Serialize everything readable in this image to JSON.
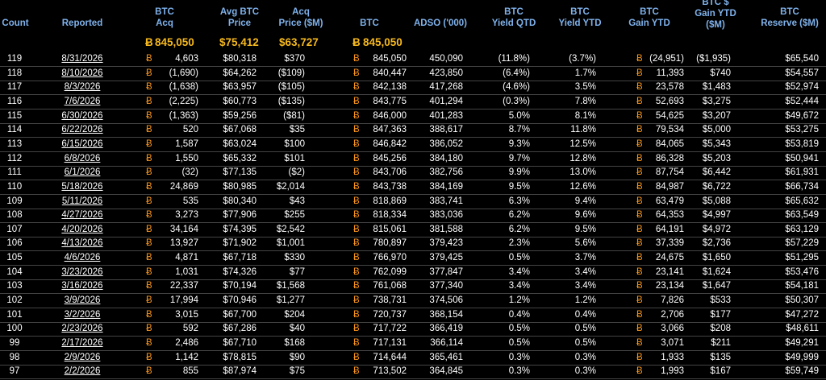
{
  "headers": {
    "count": "Count",
    "reported": "Reported",
    "btc_acq_1": "BTC",
    "btc_acq_2": "Acq",
    "avg_1": "Avg BTC",
    "avg_2": "Price",
    "acqp_1": "Acq",
    "acqp_2": "Price ($M)",
    "btc": "BTC",
    "adso": "ADSO ('000)",
    "qtd_1": "BTC",
    "qtd_2": "Yield QTD",
    "ytd_1": "BTC",
    "ytd_2": "Yield YTD",
    "gain_1": "BTC",
    "gain_2": "Gain YTD",
    "gainusd_1": "BTC $",
    "gainusd_2": "Gain YTD",
    "gainusd_3": "($M)",
    "res_1": "BTC",
    "res_2": "Reserve ($M)"
  },
  "btc_symbol": "Ƀ",
  "summary": {
    "btc_acq": "845,050",
    "avg_price": "$75,412",
    "acq_price": "$63,727",
    "btc": "845,050"
  },
  "colors": {
    "header": "#7fb2ec",
    "btc_symbol": "#f7931a",
    "summary": "#f6b91e",
    "background": "#000000"
  },
  "rows": [
    {
      "count": "119",
      "reported": "8/31/2026",
      "acq": "4,603",
      "avg": "$80,318",
      "acqp": "$370",
      "btc": "845,050",
      "adso": "450,090",
      "qtd": "(11.8%)",
      "ytd": "(3.7%)",
      "gain": "(24,951)",
      "gainusd": "($1,935)",
      "res": "$65,540"
    },
    {
      "count": "118",
      "reported": "8/10/2026",
      "acq": "(1,690)",
      "avg": "$64,262",
      "acqp": "($109)",
      "btc": "840,447",
      "adso": "423,850",
      "qtd": "(6.4%)",
      "ytd": "1.7%",
      "gain": "11,393",
      "gainusd": "$740",
      "res": "$54,557"
    },
    {
      "count": "117",
      "reported": "8/3/2026",
      "acq": "(1,638)",
      "avg": "$63,957",
      "acqp": "($105)",
      "btc": "842,138",
      "adso": "417,268",
      "qtd": "(4.6%)",
      "ytd": "3.5%",
      "gain": "23,578",
      "gainusd": "$1,483",
      "res": "$52,974"
    },
    {
      "count": "116",
      "reported": "7/6/2026",
      "acq": "(2,225)",
      "avg": "$60,773",
      "acqp": "($135)",
      "btc": "843,775",
      "adso": "401,294",
      "qtd": "(0.3%)",
      "ytd": "7.8%",
      "gain": "52,693",
      "gainusd": "$3,275",
      "res": "$52,444"
    },
    {
      "count": "115",
      "reported": "6/30/2026",
      "acq": "(1,363)",
      "avg": "$59,256",
      "acqp": "($81)",
      "btc": "846,000",
      "adso": "401,283",
      "qtd": "5.0%",
      "ytd": "8.1%",
      "gain": "54,625",
      "gainusd": "$3,207",
      "res": "$49,672"
    },
    {
      "count": "114",
      "reported": "6/22/2026",
      "acq": "520",
      "avg": "$67,068",
      "acqp": "$35",
      "btc": "847,363",
      "adso": "388,617",
      "qtd": "8.7%",
      "ytd": "11.8%",
      "gain": "79,534",
      "gainusd": "$5,000",
      "res": "$53,275"
    },
    {
      "count": "113",
      "reported": "6/15/2026",
      "acq": "1,587",
      "avg": "$63,024",
      "acqp": "$100",
      "btc": "846,842",
      "adso": "386,052",
      "qtd": "9.3%",
      "ytd": "12.5%",
      "gain": "84,065",
      "gainusd": "$5,343",
      "res": "$53,819"
    },
    {
      "count": "112",
      "reported": "6/8/2026",
      "acq": "1,550",
      "avg": "$65,332",
      "acqp": "$101",
      "btc": "845,256",
      "adso": "384,180",
      "qtd": "9.7%",
      "ytd": "12.8%",
      "gain": "86,328",
      "gainusd": "$5,203",
      "res": "$50,941"
    },
    {
      "count": "111",
      "reported": "6/1/2026",
      "acq": "(32)",
      "avg": "$77,135",
      "acqp": "($2)",
      "btc": "843,706",
      "adso": "382,756",
      "qtd": "9.9%",
      "ytd": "13.0%",
      "gain": "87,754",
      "gainusd": "$6,442",
      "res": "$61,931"
    },
    {
      "count": "110",
      "reported": "5/18/2026",
      "acq": "24,869",
      "avg": "$80,985",
      "acqp": "$2,014",
      "btc": "843,738",
      "adso": "384,169",
      "qtd": "9.5%",
      "ytd": "12.6%",
      "gain": "84,987",
      "gainusd": "$6,722",
      "res": "$66,734"
    },
    {
      "count": "109",
      "reported": "5/11/2026",
      "acq": "535",
      "avg": "$80,340",
      "acqp": "$43",
      "btc": "818,869",
      "adso": "383,741",
      "qtd": "6.3%",
      "ytd": "9.4%",
      "gain": "63,479",
      "gainusd": "$5,088",
      "res": "$65,632"
    },
    {
      "count": "108",
      "reported": "4/27/2026",
      "acq": "3,273",
      "avg": "$77,906",
      "acqp": "$255",
      "btc": "818,334",
      "adso": "383,036",
      "qtd": "6.2%",
      "ytd": "9.6%",
      "gain": "64,353",
      "gainusd": "$4,997",
      "res": "$63,549"
    },
    {
      "count": "107",
      "reported": "4/20/2026",
      "acq": "34,164",
      "avg": "$74,395",
      "acqp": "$2,542",
      "btc": "815,061",
      "adso": "381,588",
      "qtd": "6.2%",
      "ytd": "9.5%",
      "gain": "64,191",
      "gainusd": "$4,972",
      "res": "$63,129"
    },
    {
      "count": "106",
      "reported": "4/13/2026",
      "acq": "13,927",
      "avg": "$71,902",
      "acqp": "$1,001",
      "btc": "780,897",
      "adso": "379,423",
      "qtd": "2.3%",
      "ytd": "5.6%",
      "gain": "37,339",
      "gainusd": "$2,736",
      "res": "$57,229"
    },
    {
      "count": "105",
      "reported": "4/6/2026",
      "acq": "4,871",
      "avg": "$67,718",
      "acqp": "$330",
      "btc": "766,970",
      "adso": "379,425",
      "qtd": "0.5%",
      "ytd": "3.7%",
      "gain": "24,675",
      "gainusd": "$1,650",
      "res": "$51,295"
    },
    {
      "count": "104",
      "reported": "3/23/2026",
      "acq": "1,031",
      "avg": "$74,326",
      "acqp": "$77",
      "btc": "762,099",
      "adso": "377,847",
      "qtd": "3.4%",
      "ytd": "3.4%",
      "gain": "23,141",
      "gainusd": "$1,624",
      "res": "$53,476"
    },
    {
      "count": "103",
      "reported": "3/16/2026",
      "acq": "22,337",
      "avg": "$70,194",
      "acqp": "$1,568",
      "btc": "761,068",
      "adso": "377,340",
      "qtd": "3.4%",
      "ytd": "3.4%",
      "gain": "23,134",
      "gainusd": "$1,647",
      "res": "$54,181"
    },
    {
      "count": "102",
      "reported": "3/9/2026",
      "acq": "17,994",
      "avg": "$70,946",
      "acqp": "$1,277",
      "btc": "738,731",
      "adso": "374,506",
      "qtd": "1.2%",
      "ytd": "1.2%",
      "gain": "7,826",
      "gainusd": "$533",
      "res": "$50,307"
    },
    {
      "count": "101",
      "reported": "3/2/2026",
      "acq": "3,015",
      "avg": "$67,700",
      "acqp": "$204",
      "btc": "720,737",
      "adso": "368,154",
      "qtd": "0.4%",
      "ytd": "0.4%",
      "gain": "2,706",
      "gainusd": "$177",
      "res": "$47,272"
    },
    {
      "count": "100",
      "reported": "2/23/2026",
      "acq": "592",
      "avg": "$67,286",
      "acqp": "$40",
      "btc": "717,722",
      "adso": "366,419",
      "qtd": "0.5%",
      "ytd": "0.5%",
      "gain": "3,066",
      "gainusd": "$208",
      "res": "$48,611"
    },
    {
      "count": "99",
      "reported": "2/17/2026",
      "acq": "2,486",
      "avg": "$67,710",
      "acqp": "$168",
      "btc": "717,131",
      "adso": "366,114",
      "qtd": "0.5%",
      "ytd": "0.5%",
      "gain": "3,071",
      "gainusd": "$211",
      "res": "$49,291"
    },
    {
      "count": "98",
      "reported": "2/9/2026",
      "acq": "1,142",
      "avg": "$78,815",
      "acqp": "$90",
      "btc": "714,644",
      "adso": "365,461",
      "qtd": "0.3%",
      "ytd": "0.3%",
      "gain": "1,933",
      "gainusd": "$135",
      "res": "$49,999"
    },
    {
      "count": "97",
      "reported": "2/2/2026",
      "acq": "855",
      "avg": "$87,974",
      "acqp": "$75",
      "btc": "713,502",
      "adso": "364,845",
      "qtd": "0.3%",
      "ytd": "0.3%",
      "gain": "1,993",
      "gainusd": "$167",
      "res": "$59,749"
    }
  ]
}
